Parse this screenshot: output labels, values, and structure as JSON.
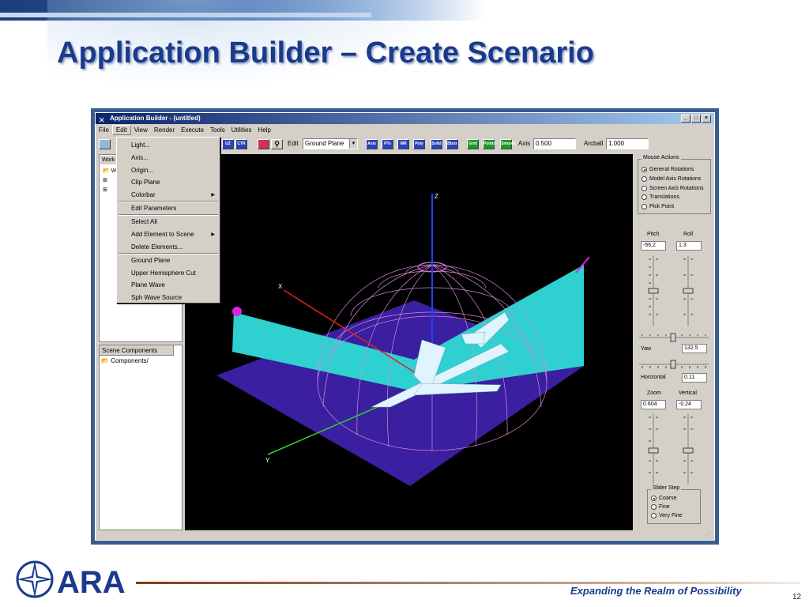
{
  "slide": {
    "title": "Application Builder – Create Scenario",
    "tagline": "Expanding the Realm of Possibility",
    "page_number": "12",
    "logo_text": "ARA"
  },
  "window": {
    "title": "Application Builder - (untitled)",
    "buttons": [
      "_",
      "□",
      "×"
    ]
  },
  "menubar": {
    "items": [
      {
        "label": "File"
      },
      {
        "label": "Edit"
      },
      {
        "label": "View"
      },
      {
        "label": "Render"
      },
      {
        "label": "Execute"
      },
      {
        "label": "Tools"
      },
      {
        "label": "Utilities"
      },
      {
        "label": "Help"
      }
    ]
  },
  "edit_menu": {
    "items": [
      {
        "label": "Light...",
        "submenu": false
      },
      {
        "label": "Axis...",
        "submenu": false
      },
      {
        "label": "Origin...",
        "submenu": false
      },
      {
        "label": "Clip Plane",
        "submenu": false
      },
      {
        "label": "Colorbar",
        "submenu": true
      },
      {
        "label": "Edit Parameters",
        "submenu": false
      },
      {
        "label": "Select All",
        "submenu": false
      },
      {
        "label": "Add Element to Scene",
        "submenu": true
      },
      {
        "label": "Delete Elements...",
        "submenu": false
      },
      {
        "label": "Ground Plane",
        "submenu": false
      },
      {
        "label": "Upper Hemisphere Cut",
        "submenu": false
      },
      {
        "label": "Plane Wave",
        "submenu": false
      },
      {
        "label": "Sph Wave Source",
        "submenu": false
      }
    ]
  },
  "toolbar": {
    "buttons": [
      "UZ",
      "CTR",
      "Axis",
      "PTs",
      "WR",
      "Poly",
      "Solid",
      "Bbox",
      "Grid",
      "Points",
      "Smooth"
    ],
    "edit_label": "Edit",
    "edit_value": "Ground Plane",
    "axis_label": "Axis",
    "axis_value": "0.500",
    "arcball_label": "Arcball",
    "arcball_value": "1.000"
  },
  "left_pane": {
    "tab_label": "Work",
    "tree_root": "W"
  },
  "scene_components": {
    "header": "Scene Components",
    "item": "Components/"
  },
  "viewport": {
    "axis_z": "Z",
    "axis_x": "X",
    "axis_y": "Y"
  },
  "mouse_actions": {
    "title": "Mouse Actions",
    "options": [
      {
        "label": "General Rotations",
        "selected": true
      },
      {
        "label": "Model Axis Rotations",
        "selected": false
      },
      {
        "label": "Screen Axis Rotations",
        "selected": false
      },
      {
        "label": "Translations",
        "selected": false
      },
      {
        "label": "Pick Point",
        "selected": false
      }
    ]
  },
  "controls": {
    "pitch_label": "Pitch",
    "pitch_value": "-56.2",
    "roll_label": "Roll",
    "roll_value": "1.3",
    "yaw_label": "Yaw",
    "yaw_value": "132.5",
    "horizontal_label": "Horizontal",
    "horizontal_value": "0.11",
    "zoom_label": "Zoom",
    "zoom_value": "0.604",
    "vertical_label": "Vertical",
    "vertical_value": "-0.24"
  },
  "slider_step": {
    "title": "Slider Step",
    "options": [
      {
        "label": "Coarse",
        "selected": true
      },
      {
        "label": "Fine",
        "selected": false
      },
      {
        "label": "Very Fine",
        "selected": false
      }
    ]
  }
}
